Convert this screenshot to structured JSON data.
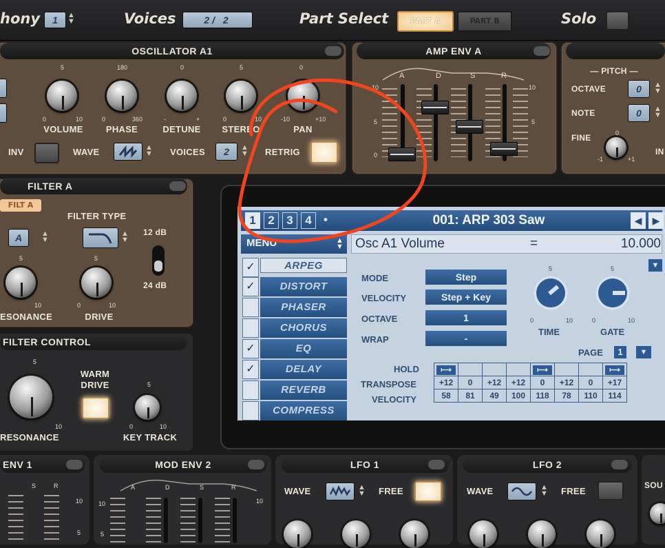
{
  "topbar": {
    "polyphony_label": "hony",
    "polyphony_value": "1",
    "voices_label": "Voices",
    "voices_value": "2/ 2",
    "part_select_label": "Part Select",
    "part_a": "PART A",
    "part_b": "PART B",
    "solo_label": "Solo"
  },
  "osc": {
    "title": "OSCILLATOR A1",
    "knobs": [
      {
        "label": "VOLUME",
        "top": "5",
        "min": "0",
        "max": "10"
      },
      {
        "label": "PHASE",
        "top": "180",
        "min": "0",
        "max": "360"
      },
      {
        "label": "DETUNE",
        "top": "0",
        "min": "-",
        "max": "+"
      },
      {
        "label": "STEREO",
        "top": "5",
        "min": "0",
        "max": "10"
      },
      {
        "label": "PAN",
        "top": "0",
        "min": "-10",
        "max": "+10"
      }
    ],
    "inv_label": "INV",
    "wave_label": "WAVE",
    "voices_label": "VOICES",
    "voices_value": "2",
    "retrig_label": "RETRIG"
  },
  "ampenv": {
    "title": "AMP ENV A",
    "stages": [
      "A",
      "D",
      "S",
      "R"
    ],
    "scale_top": "10",
    "scale_mid": "5",
    "scale_bot": "0"
  },
  "pitch": {
    "title": "PITCH",
    "octave_label": "OCTAVE",
    "octave_value": "0",
    "note_label": "NOTE",
    "note_value": "0",
    "fine_label": "FINE",
    "fine_top": "0",
    "fine_min": "-1",
    "fine_max": "+1",
    "cut": "IN"
  },
  "filter": {
    "title": "FILTER A",
    "filt_a": "FILT A",
    "type_label": "FILTER TYPE",
    "a_value": "A",
    "db12": "12 dB",
    "db24": "24 dB",
    "resonance_label": "RESONANCE",
    "drive_label": "DRIVE",
    "knob_top": "5",
    "knob_min": "0",
    "knob_max": "10"
  },
  "filter_control": {
    "title": "FILTER CONTROL",
    "warm_drive": "WARM DRIVE",
    "resonance_label": "RESONANCE",
    "key_track_label": "KEY TRACK",
    "knob_top": "5",
    "knob_min": "0",
    "knob_max": "10"
  },
  "screen": {
    "pages": [
      "1",
      "2",
      "3",
      "4",
      "•"
    ],
    "patch_name": "001: ARP 303 Saw",
    "menu_label": "MENU",
    "param_name": "Osc A1 Volume",
    "param_eq": "=",
    "param_value": "10.000",
    "fx": [
      {
        "name": "ARPEG",
        "checked": true
      },
      {
        "name": "DISTORT",
        "checked": true
      },
      {
        "name": "PHASER",
        "checked": false
      },
      {
        "name": "CHORUS",
        "checked": false
      },
      {
        "name": "EQ",
        "checked": true
      },
      {
        "name": "DELAY",
        "checked": true
      },
      {
        "name": "REVERB",
        "checked": false
      },
      {
        "name": "COMPRESS",
        "checked": false
      }
    ],
    "check_mark": "✓",
    "mode_label": "MODE",
    "mode_value": "Step",
    "velocity_label": "VELOCITY",
    "velocity_value": "Step + Key",
    "octave_label": "OCTAVE",
    "octave_value": "1",
    "wrap_label": "WRAP",
    "wrap_value": "-",
    "time_label": "TIME",
    "gate_label": "GATE",
    "knob_top": "5",
    "knob_min": "0",
    "knob_max": "10",
    "page_label": "PAGE",
    "page_value": "1",
    "hold_label": "HOLD",
    "transpose_label": "TRANSPOSE",
    "seq_velocity_label": "VELOCITY",
    "hold_marker": "⟼",
    "hold": [
      true,
      false,
      false,
      false,
      true,
      false,
      false,
      true
    ],
    "transpose": [
      "+12",
      "0",
      "+12",
      "+12",
      "0",
      "+12",
      "0",
      "+17"
    ],
    "velocity": [
      "58",
      "81",
      "49",
      "100",
      "118",
      "78",
      "110",
      "114"
    ]
  },
  "bottom": {
    "env1": "ENV 1",
    "modenv2": "MOD ENV 2",
    "lfo1": "LFO 1",
    "lfo2": "LFO 2",
    "wave_label": "WAVE",
    "free_label": "FREE",
    "sou": "SOU",
    "stages": [
      "A",
      "D",
      "S",
      "R"
    ],
    "ten": "10",
    "five": "5"
  },
  "colors": {
    "panel_brown": "#5e4c3d",
    "lcd_blue": "#3e6ca4",
    "annotation_red": "#f0451e",
    "button_glow": "#f3d19a"
  }
}
